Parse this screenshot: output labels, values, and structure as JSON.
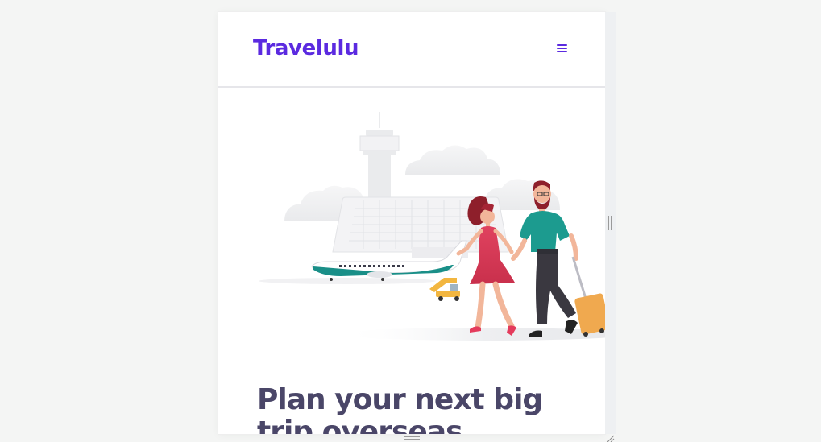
{
  "header": {
    "brand": "Travelulu",
    "menu_icon": "hamburger-menu-icon"
  },
  "hero": {
    "illustration": "airport-couple-illustration",
    "headline": "Plan your next big trip overseas"
  },
  "colors": {
    "brand": "#5b2ae0",
    "headline": "#4a4668",
    "page_background": "#f4f5f4"
  },
  "icons": {
    "vertical_resize": "vertical-resize-grip-icon",
    "horizontal_resize": "horizontal-resize-grip-icon",
    "corner_resize": "corner-resize-icon"
  }
}
